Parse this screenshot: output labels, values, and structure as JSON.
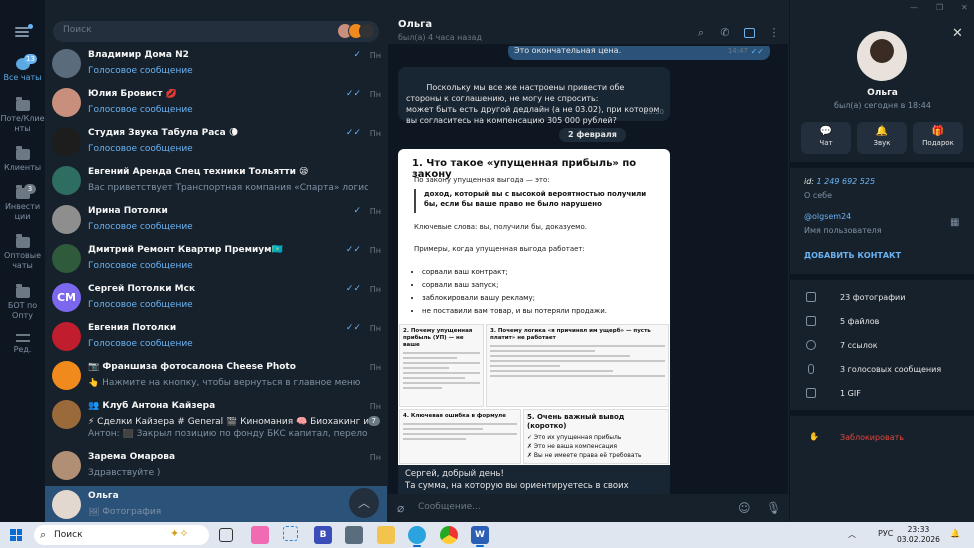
{
  "rail": {
    "items": [
      {
        "label": "Все чаты",
        "badge": "13"
      },
      {
        "label": "Поте/Клие нты",
        "badge": ""
      },
      {
        "label": "Клиенты",
        "badge": ""
      },
      {
        "label": "Инвести ции",
        "badge": "3"
      },
      {
        "label": "Оптовые чаты",
        "badge": ""
      },
      {
        "label": "БОТ по Опту",
        "badge": ""
      },
      {
        "label": "Ред.",
        "badge": ""
      }
    ]
  },
  "search": {
    "placeholder": "Поиск"
  },
  "chats": [
    {
      "name": "Владимир Дома N2",
      "preview": "Голосовое сообщение",
      "time": "Пн",
      "ticks": "✓",
      "avatar_color": "#5a6b7c"
    },
    {
      "name": "Юлия Бровист 💋",
      "preview": "Голосовое сообщение",
      "time": "Пн",
      "ticks": "✓✓",
      "avatar_color": "#c98f7d"
    },
    {
      "name": "Студия Звука Табула Раса 🌘",
      "preview": "Голосовое сообщение",
      "time": "Пн",
      "ticks": "✓✓",
      "avatar_color": "#1d1d1d"
    },
    {
      "name": "Евгений Аренда Спец техники Тольятти 😪",
      "preview": "Вас приветствует Транспортная компания «Спарта» логист по мани...",
      "time": "",
      "ticks": "",
      "avatar_color": "#2e6e60"
    },
    {
      "name": "Ирина Потолки",
      "preview": "Голосовое сообщение",
      "time": "Пн",
      "ticks": "✓",
      "avatar_color": "#8e8e8e"
    },
    {
      "name": "Дмитрий Ремонт Квартир Премиум🇰🇿",
      "preview": "Голосовое сообщение",
      "time": "Пн",
      "ticks": "✓✓",
      "avatar_color": "#2f5a3b"
    },
    {
      "name": "Сергей Потолки Мск",
      "preview": "Голосовое сообщение",
      "time": "Пн",
      "ticks": "✓✓",
      "avatar_letters": "СМ"
    },
    {
      "name": "Евгения Потолки",
      "preview": "Голосовое сообщение",
      "time": "Пн",
      "ticks": "✓✓",
      "avatar_color": "#c01e2e"
    },
    {
      "name": "📷 Франшиза фотосалона Cheese Photo",
      "preview": "👆 Нажмите на кнопку, чтобы вернуться в главное меню",
      "time": "Пн",
      "ticks": "",
      "avatar_color": "#f08a1c"
    },
    {
      "name": "👥 Клуб Антона Кайзера",
      "preview": "⚡ Сделки Кайзера  # General  🎬 Киномания  🧠 Биохакинг и н...",
      "preview2": "Антон: ⬛ Закрыл позицию по фонду БКС капитал, переложился в ...",
      "time": "Пн",
      "ticks": "",
      "count": "7",
      "avatar_color": "#9b6a3a"
    },
    {
      "name": "Зарема Омарова",
      "preview": "Здравствуйте )",
      "time": "Пн",
      "ticks": "",
      "avatar_color": "#b08f75"
    },
    {
      "name": "Ольга",
      "preview": "🖼 Фотография",
      "time": "",
      "ticks": "",
      "avatar_color": "#e2d8d0"
    }
  ],
  "conversation": {
    "title": "Ольга",
    "status": "был(а) 4 часа назад",
    "msg_out_top": "Это окончательная цена.",
    "msg_out_top_time": "14:47",
    "msg_in": "Поскольку мы все же настроены привести обе стороны к соглашению, не могу не спросить:\nможет быть есть другой дедлайн (а не 03.02), при котором вы согласитесь на компенсацию 305 000 рублей?",
    "msg_in_time": "15:30",
    "date_pill": "2 февраля",
    "doc": {
      "title": "1. Что такое «упущенная прибыль» по закону",
      "p1": "По закону упущенная выгода — это:",
      "quote": "доход, который вы с высокой вероятностью получили бы, если бы ваше право не было нарушено",
      "p2": "Ключевые слова: вы, получили бы, доказуемо.",
      "p3": "Примеры, когда упущенная выгода работает:",
      "list": [
        "сорвали ваш контракт;",
        "сорвали ваш запуск;",
        "заблокировали вашу рекламу;",
        "не поставили вам товар, и вы потеряли продажи."
      ]
    },
    "tiles": [
      {
        "title": "2. Почему упущенная прибыль (УП) — не ваше"
      },
      {
        "title": "3. Почему логика «я причинял им ущерб» — пусть платит» не работает"
      },
      {
        "title": "4. Ключевая ошибка в формуле"
      },
      {
        "title": "5. Очень важный вывод (коротко)",
        "items": [
          "✓ Это их упущенная прибыль",
          "✗ Это не ваша компенсация",
          "✗ Вы не имеете права её требовать"
        ]
      }
    ],
    "caption": "Сергей, добрый день!\nТа сумма, на которую вы ориентируетесь в своих расчетах - это",
    "composer_placeholder": "Сообщение..."
  },
  "profile": {
    "name": "Ольга",
    "seen": "был(а) сегодня в 18:44",
    "buttons": [
      "Чат",
      "Звук",
      "Подарок"
    ],
    "id_label": "id:",
    "id_value": "1 249 692 525",
    "about": "О себе",
    "username": "@olgsem24",
    "username_label": "Имя пользователя",
    "add_contact": "ДОБАВИТЬ КОНТАКТ",
    "stats": [
      "23 фотографии",
      "5 файлов",
      "7 ссылок",
      "3 голосовых сообщения",
      "1 GIF"
    ],
    "block": "Заблокировать"
  },
  "taskbar": {
    "search": "Поиск",
    "lang": "РУС",
    "time": "23:33",
    "date": "03.02.2026",
    "accent": "#0a6cd1"
  }
}
